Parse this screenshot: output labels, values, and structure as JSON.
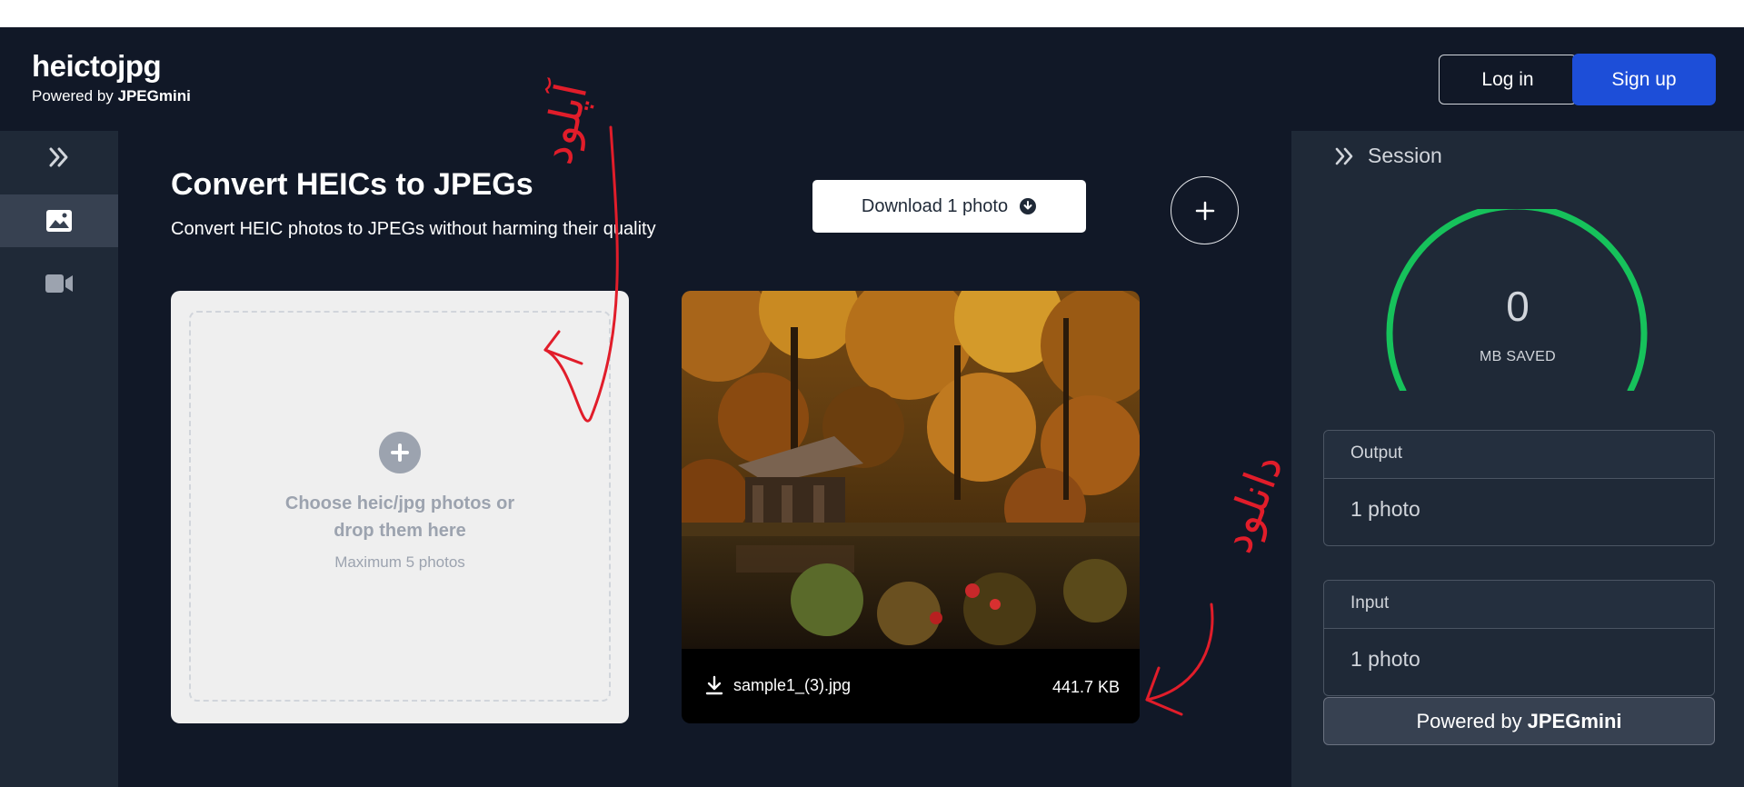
{
  "header": {
    "brand_name": "heictojpg",
    "powered_prefix": "Powered by",
    "powered_brand": "JPEGmini",
    "login_label": "Log in",
    "signup_label": "Sign up"
  },
  "rail": {
    "items": [
      {
        "icon": "chevrons-right-icon"
      },
      {
        "icon": "image-icon",
        "active": true
      },
      {
        "icon": "video-icon"
      }
    ]
  },
  "main": {
    "title": "Convert HEICs to JPEGs",
    "subtitle": "Convert HEIC photos to JPEGs without harming their quality",
    "download_label": "Download 1 photo",
    "dropzone": {
      "text": "Choose heic/jpg photos or drop them here",
      "max_text": "Maximum 5 photos"
    },
    "photo": {
      "filename": "sample1_(3).jpg",
      "size": "441.7 KB"
    }
  },
  "session": {
    "title": "Session",
    "gauge_value": "0",
    "gauge_label": "MB SAVED",
    "gauge_fraction": 0,
    "gauge_color": "#16c25b",
    "output": {
      "label": "Output",
      "value": "1 photo"
    },
    "input": {
      "label": "Input",
      "value": "1 photo"
    },
    "powered_prefix": "Powered by",
    "powered_brand": "JPEGmini"
  },
  "annotations": {
    "upload_text": "آپلود",
    "download_text": "دانلود",
    "color": "#e11d2a"
  },
  "colors": {
    "header_bg": "#111827",
    "panel_bg": "#1f2937",
    "accent_blue": "#1d4ed8"
  }
}
